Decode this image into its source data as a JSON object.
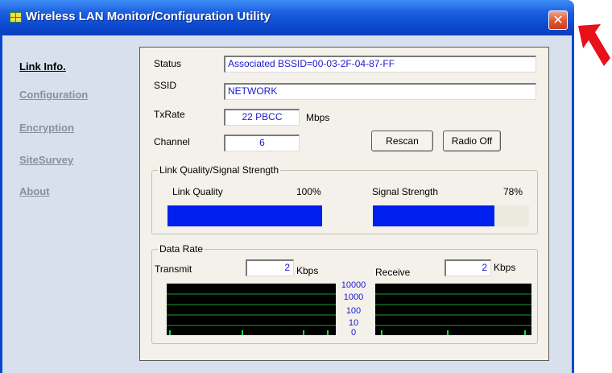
{
  "window": {
    "title": "Wireless LAN Monitor/Configuration Utility",
    "close_symbol": "✕",
    "titlebar_color": "#0a47cf"
  },
  "sidebar": {
    "items": [
      {
        "label": "Link Info.",
        "active": true
      },
      {
        "label": "Configuration",
        "active": false
      },
      {
        "label": "Encryption",
        "active": false
      },
      {
        "label": "SiteSurvey",
        "active": false
      },
      {
        "label": "About",
        "active": false
      }
    ]
  },
  "status": {
    "status_label": "Status",
    "status_value": "Associated BSSID=00-03-2F-04-87-FF",
    "ssid_label": "SSID",
    "ssid_value": "NETWORK",
    "txrate_label": "TxRate",
    "txrate_value": "22 PBCC",
    "txrate_unit": "Mbps",
    "channel_label": "Channel",
    "channel_value": "6"
  },
  "buttons": {
    "rescan": "Rescan",
    "radio_off": "Radio Off"
  },
  "link_quality": {
    "group_title": "Link Quality/Signal Strength",
    "quality_label": "Link Quality",
    "quality_text": "100%",
    "quality_fraction": 1.0,
    "signal_label": "Signal Strength",
    "signal_text": "78%",
    "signal_fraction": 0.78,
    "bar_color": "#0020f0"
  },
  "data_rate": {
    "group_title": "Data Rate",
    "transmit_label": "Transmit",
    "transmit_value": "2",
    "transmit_unit": "Kbps",
    "receive_label": "Receive",
    "receive_value": "2",
    "receive_unit": "Kbps",
    "scale": [
      "10000",
      "1000",
      "100",
      "10",
      "0"
    ],
    "graph_line_color": "#1a9e2a"
  },
  "pointer": {
    "icon": "red-arrow-icon",
    "color": "#e8101a"
  }
}
